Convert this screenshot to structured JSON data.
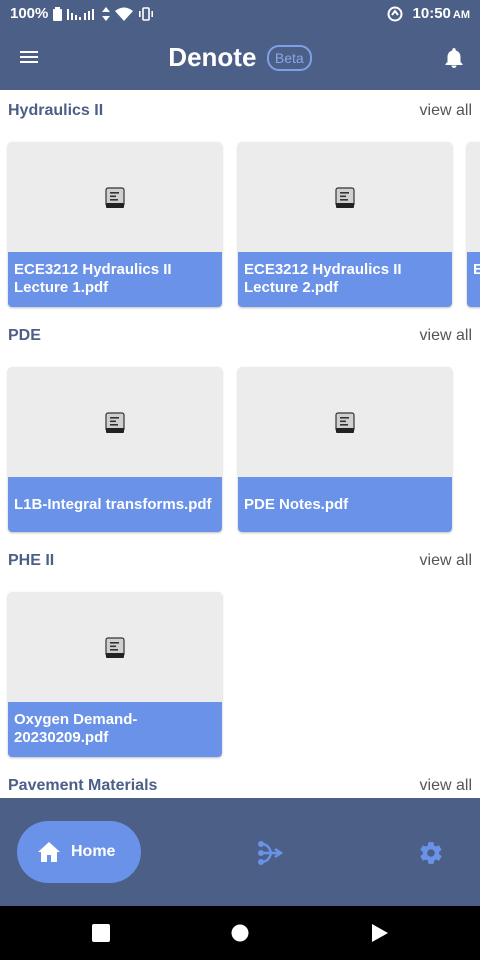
{
  "status_bar": {
    "battery": "100%",
    "time": "10:50",
    "ampm": "AM"
  },
  "app_bar": {
    "title": "Denote",
    "badge": "Beta"
  },
  "sections": [
    {
      "title": "Hydraulics II",
      "view_all": "view all",
      "files": [
        "ECE3212 Hydraulics II Lecture 1.pdf",
        "ECE3212 Hydraulics II Lecture 2.pdf",
        "E L"
      ]
    },
    {
      "title": "PDE",
      "view_all": "view all",
      "files": [
        "L1B-Integral transforms.pdf",
        "PDE Notes.pdf"
      ]
    },
    {
      "title": "PHE II",
      "view_all": "view all",
      "files": [
        "Oxygen Demand-20230209.pdf"
      ]
    },
    {
      "title": "Pavement Materials",
      "view_all": "view all",
      "files": []
    }
  ],
  "bottom_nav": {
    "home_label": "Home"
  },
  "colors": {
    "header": "#4c5f86",
    "accent": "#6a92e8",
    "card_thumb": "#ececec"
  }
}
